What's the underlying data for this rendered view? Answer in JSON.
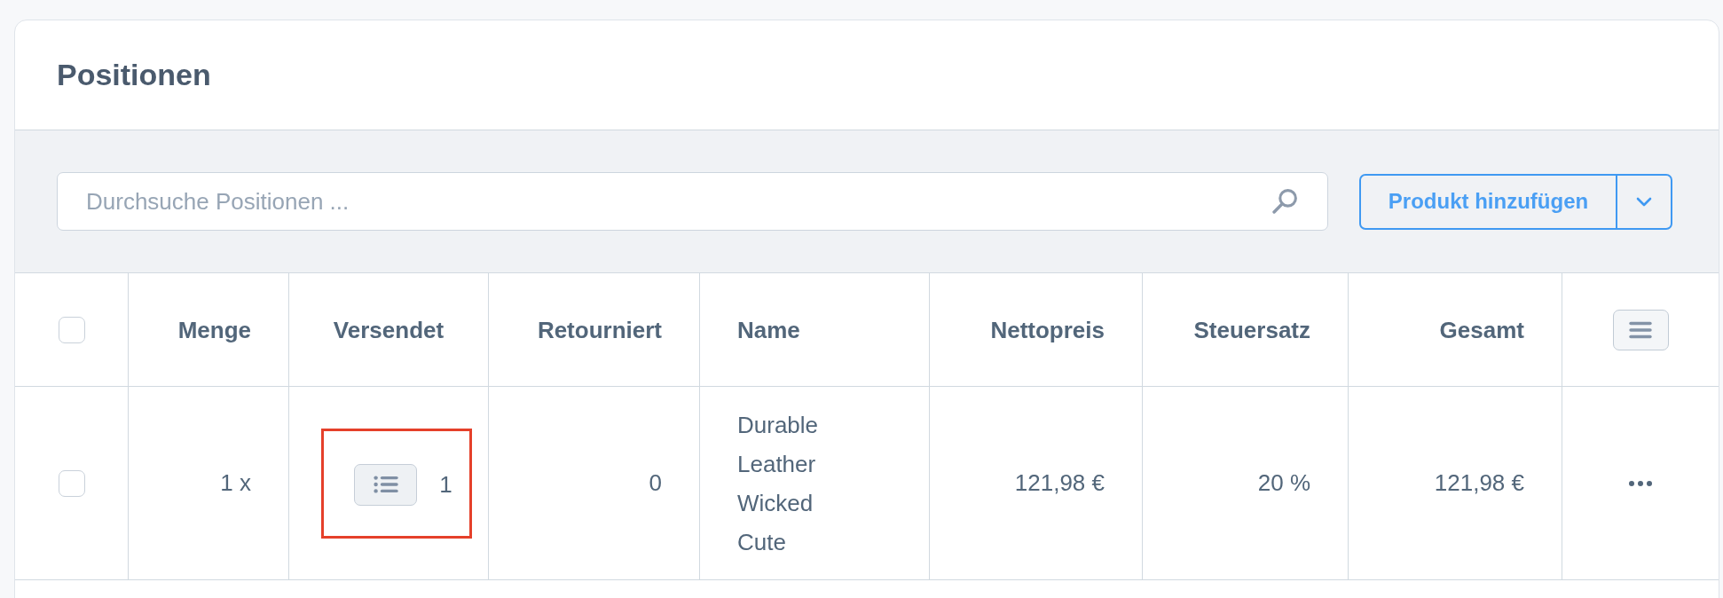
{
  "card": {
    "title": "Positionen"
  },
  "toolbar": {
    "search": {
      "placeholder": "Durchsuche Positionen ..."
    },
    "add_button": {
      "label": "Produkt hinzufügen"
    }
  },
  "table": {
    "select_all": {
      "checked": false
    },
    "columns": [
      "Menge",
      "Versendet",
      "Retourniert",
      "Name",
      "Nettopreis",
      "Steuersatz",
      "Gesamt"
    ],
    "rows": [
      {
        "checked": false,
        "quantity": "1 x",
        "shipped": {
          "count": "1",
          "highlighted": true
        },
        "returned": "0",
        "name": "Durable Leather Wicked Cute",
        "net_price": "121,98 €",
        "tax_rate": "20 %",
        "total": "121,98 €"
      }
    ]
  }
}
